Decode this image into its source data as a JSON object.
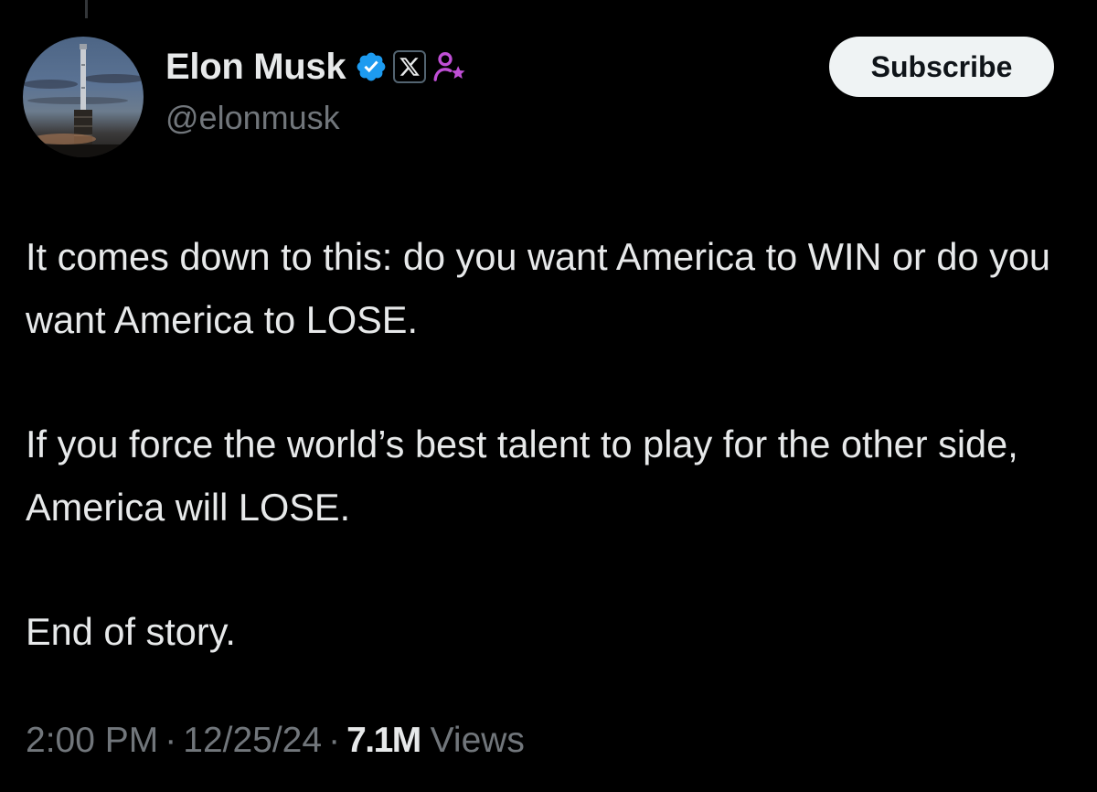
{
  "author": {
    "display_name": "Elon Musk",
    "handle": "@elonmusk"
  },
  "icons": {
    "verified": "verified-badge-icon",
    "affiliation": "x-logo-icon",
    "affiliate_badge": "affiliate-person-star-icon"
  },
  "subscribe_label": "Subscribe",
  "tweet": {
    "paragraphs": [
      "It comes down to this: do you want America to WIN or do you want America to LOSE.",
      "If you force the world’s best talent to play for the other side, America will LOSE.",
      "End of story."
    ],
    "time": "2:00 PM",
    "separator": "·",
    "date": "12/25/24",
    "view_count": "7.1M",
    "views_label": "Views"
  },
  "colors": {
    "background": "#000000",
    "primary_text": "#e7e9ea",
    "secondary_text": "#71767b",
    "verified_blue": "#1d9bf0",
    "affiliate_purple": "#c04fd6",
    "button_bg": "#eff3f4"
  }
}
